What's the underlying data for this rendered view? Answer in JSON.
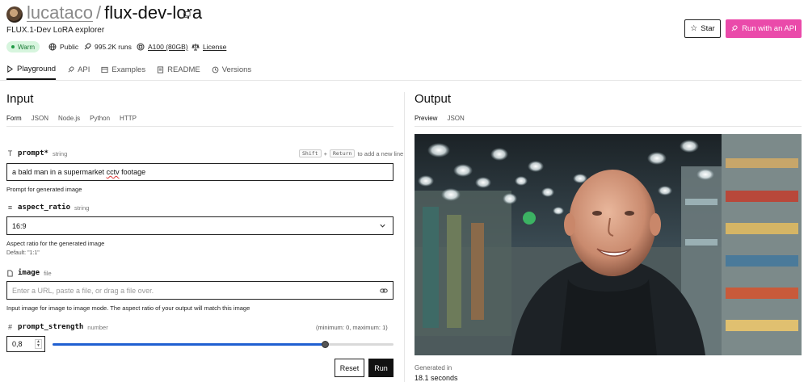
{
  "repo": {
    "owner": "lucataco",
    "separator": "/",
    "name": "flux-dev-lora",
    "description": "FLUX.1-Dev LoRA explorer"
  },
  "badges": {
    "status": "Warm",
    "visibility": "Public",
    "runs": "995.2K runs",
    "hardware": "A100 (80GB)",
    "license": "License"
  },
  "header_buttons": {
    "star": "Star",
    "run_api": "Run with an API"
  },
  "tabs": [
    {
      "label": "Playground",
      "icon": "play-icon"
    },
    {
      "label": "API",
      "icon": "rocket-icon"
    },
    {
      "label": "Examples",
      "icon": "examples-icon"
    },
    {
      "label": "README",
      "icon": "document-icon"
    },
    {
      "label": "Versions",
      "icon": "history-icon"
    }
  ],
  "input": {
    "heading": "Input",
    "subtabs": [
      "Form",
      "JSON",
      "Node.js",
      "Python",
      "HTTP"
    ],
    "prompt": {
      "name": "prompt*",
      "type": "string",
      "hint_key1": "Shift",
      "hint_plus": "+",
      "hint_key2": "Return",
      "hint_text": "to add a new line",
      "value_before": "a bald man in a supermarket ",
      "value_misspelled": "cctv",
      "value_after": " footage",
      "description": "Prompt for generated image"
    },
    "aspect_ratio": {
      "name": "aspect_ratio",
      "type": "string",
      "value": "16:9",
      "description": "Aspect ratio for the generated image",
      "default": "Default: \"1:1\""
    },
    "image": {
      "name": "image",
      "type": "file",
      "placeholder": "Enter a URL, paste a file, or drag a file over.",
      "description": "Input image for image to image mode. The aspect ratio of your output will match this image"
    },
    "prompt_strength": {
      "name": "prompt_strength",
      "type": "number",
      "range": "(minimum: 0, maximum: 1)",
      "value": "0,8",
      "level": 0.8
    },
    "buttons": {
      "reset": "Reset",
      "run": "Run"
    }
  },
  "output": {
    "heading": "Output",
    "subtabs": [
      "Preview",
      "JSON"
    ],
    "generated_label": "Generated in",
    "generated_time": "18.1 seconds"
  },
  "colors": {
    "accent_pink": "#ea4aaa",
    "warm_green": "#177a33",
    "slider_blue": "#1f5fd1"
  }
}
